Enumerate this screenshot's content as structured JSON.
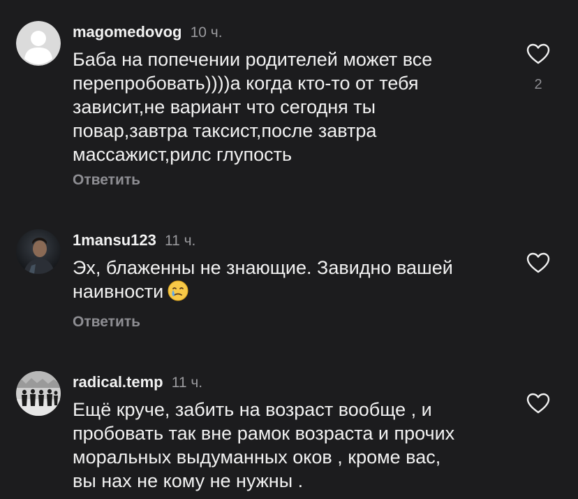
{
  "comments": [
    {
      "username": "magomedovog",
      "time": "10 ч.",
      "lines": [
        "Баба на попечении родителей может все",
        "перепробовать))))а когда кто-то от тебя",
        "зависит,не вариант что сегодня ты",
        "повар,завтра таксист,после завтра",
        "массажист,рилс глупость"
      ],
      "reply_label": "Ответить",
      "like_count": "2",
      "avatar": "default-avatar-icon"
    },
    {
      "username": "1mansu123",
      "time": "11 ч.",
      "lines": [
        "Эх, блаженны не знающие. Завидно вашей",
        "наивности"
      ],
      "emoji": "crying-face-emoji",
      "reply_label": "Ответить",
      "avatar": "photo-avatar"
    },
    {
      "username": "radical.temp",
      "time": "11 ч.",
      "lines": [
        "Ещё круче,  забить на возраст вообще , и",
        "пробовать так вне рамок возраста и прочих",
        "моральных выдуманных оков , кроме вас,",
        "вы нах не кому не нужны ."
      ],
      "avatar": "group-photo-avatar"
    }
  ],
  "colors": {
    "background": "#1c1c1e",
    "text": "#f2f2f2",
    "secondary": "#8e8e93"
  }
}
